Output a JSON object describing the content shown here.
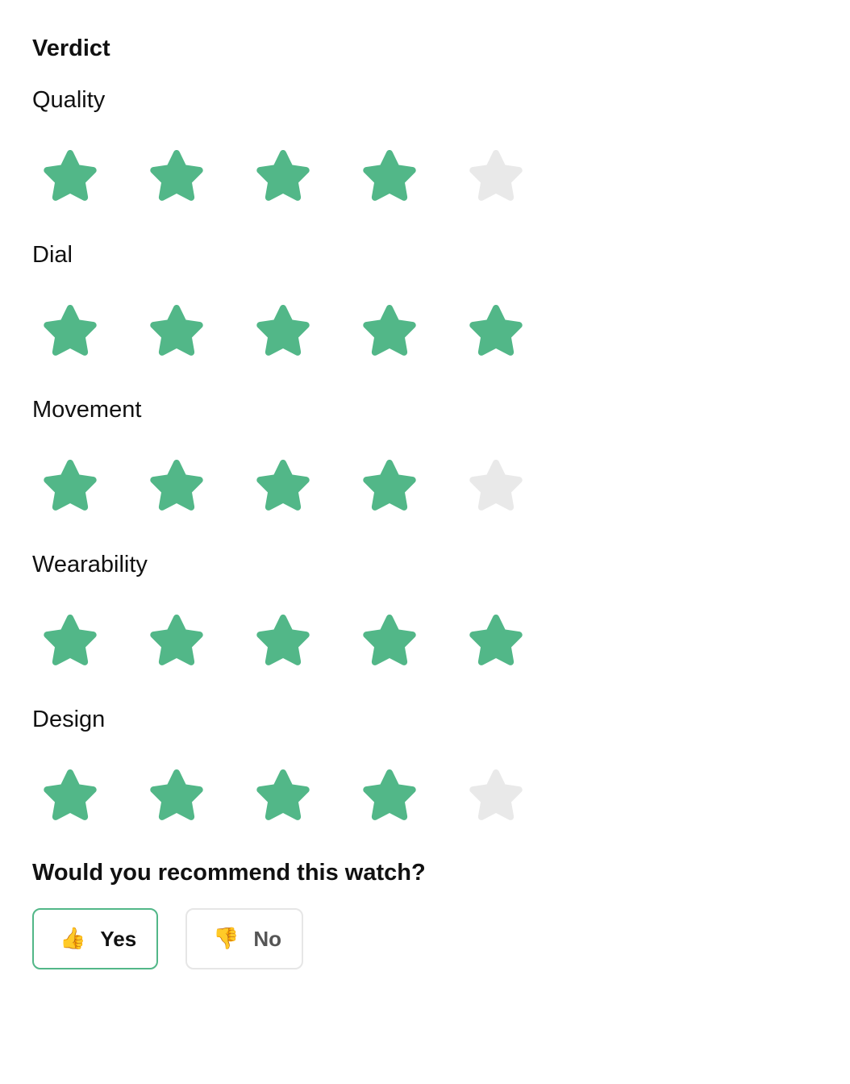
{
  "verdict": {
    "title": "Verdict",
    "max_stars": 5,
    "colors": {
      "filled_star": "#52b788",
      "empty_star": "#e9e9e9"
    },
    "categories": [
      {
        "label": "Quality",
        "rating": 4
      },
      {
        "label": "Dial",
        "rating": 5
      },
      {
        "label": "Movement",
        "rating": 4
      },
      {
        "label": "Wearability",
        "rating": 5
      },
      {
        "label": "Design",
        "rating": 4
      }
    ]
  },
  "recommend": {
    "question": "Would you recommend this watch?",
    "yes": {
      "label": "Yes",
      "icon": "thumbs-up-icon",
      "glyph": "👍",
      "selected": true
    },
    "no": {
      "label": "No",
      "icon": "thumbs-down-icon",
      "glyph": "👎",
      "selected": false
    },
    "colors": {
      "selected_border": "#52b788",
      "unselected_border": "#e6e6e6"
    }
  }
}
